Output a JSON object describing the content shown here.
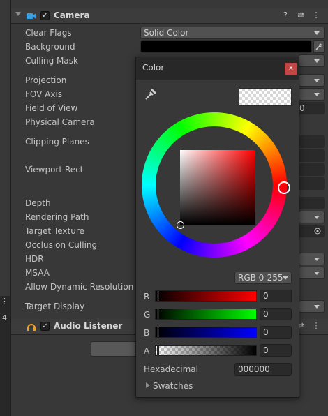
{
  "sidebar": {
    "kebab": "⋮",
    "number": "4"
  },
  "camera": {
    "title": "Camera",
    "enabled_check": "✓",
    "header_icons": {
      "help": "?",
      "presets": "⇄",
      "menu": "⋮"
    },
    "properties": [
      {
        "label": "Clear Flags"
      },
      {
        "label": "Background"
      },
      {
        "label": "Culling Mask"
      },
      {
        "label": "Projection"
      },
      {
        "label": "FOV Axis"
      },
      {
        "label": "Field of View"
      },
      {
        "label": "Physical Camera"
      },
      {
        "label": "Clipping Planes"
      },
      {
        "label": "Viewport Rect"
      },
      {
        "label": "Depth"
      },
      {
        "label": "Rendering Path"
      },
      {
        "label": "Target Texture"
      },
      {
        "label": "Occlusion Culling"
      },
      {
        "label": "HDR"
      },
      {
        "label": "MSAA"
      },
      {
        "label": "Allow Dynamic Resolution"
      },
      {
        "label": "Target Display"
      }
    ],
    "clear_flags_value": "Solid Color",
    "fov_value_partial": "0",
    "background_color": "#000000"
  },
  "audio_listener": {
    "title": "Audio Listener",
    "enabled_check": "✓",
    "header_icons": {
      "presets": "⇄",
      "menu": "⋮"
    }
  },
  "color_picker": {
    "title": "Color",
    "close": "x",
    "mode": "RGB 0-255",
    "channels": [
      {
        "label": "R",
        "value": "0"
      },
      {
        "label": "G",
        "value": "0"
      },
      {
        "label": "B",
        "value": "0"
      },
      {
        "label": "A",
        "value": "0"
      }
    ],
    "hex_label": "Hexadecimal",
    "hex_value": "000000",
    "swatches_label": "Swatches"
  }
}
